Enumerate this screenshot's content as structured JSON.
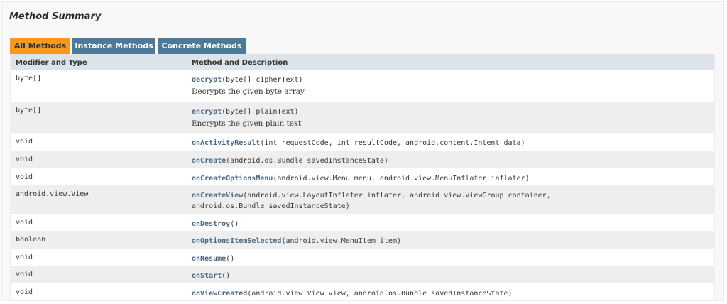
{
  "section": {
    "title": "Method Summary"
  },
  "tabs": [
    {
      "label": "All Methods",
      "active": true
    },
    {
      "label": "Instance Methods",
      "active": false
    },
    {
      "label": "Concrete Methods",
      "active": false
    }
  ],
  "table": {
    "columns": [
      "Modifier and Type",
      "Method and Description"
    ],
    "rows": [
      {
        "type": "byte[]",
        "method": "decrypt",
        "params": "(byte[] cipherText)",
        "description": "Decrypts the given byte array"
      },
      {
        "type": "byte[]",
        "method": "encrypt",
        "params": "(byte[] plainText)",
        "description": "Encrypts the given plain text"
      },
      {
        "type": "void",
        "method": "onActivityResult",
        "params": "(int requestCode, int resultCode, android.content.Intent data)"
      },
      {
        "type": "void",
        "method": "onCreate",
        "params": "(android.os.Bundle savedInstanceState)"
      },
      {
        "type": "void",
        "method": "onCreateOptionsMenu",
        "params": "(android.view.Menu menu, android.view.MenuInflater inflater)"
      },
      {
        "type": "android.view.View",
        "method": "onCreateView",
        "params": "(android.view.LayoutInflater inflater, android.view.ViewGroup container,",
        "params_line2": "android.os.Bundle savedInstanceState)"
      },
      {
        "type": "void",
        "method": "onDestroy",
        "params": "()"
      },
      {
        "type": "boolean",
        "method": "onOptionsItemSelected",
        "params": "(android.view.MenuItem item)"
      },
      {
        "type": "void",
        "method": "onResume",
        "params": "()"
      },
      {
        "type": "void",
        "method": "onStart",
        "params": "()"
      },
      {
        "type": "void",
        "method": "onViewCreated",
        "params": "(android.view.View view, android.os.Bundle savedInstanceState)"
      }
    ]
  },
  "colors": {
    "tab_active": "#f8981d",
    "tab_inactive": "#4d7a97",
    "header_bg": "#dee3e9",
    "row_alt": "#eeeeef",
    "link": "#4a6782"
  }
}
